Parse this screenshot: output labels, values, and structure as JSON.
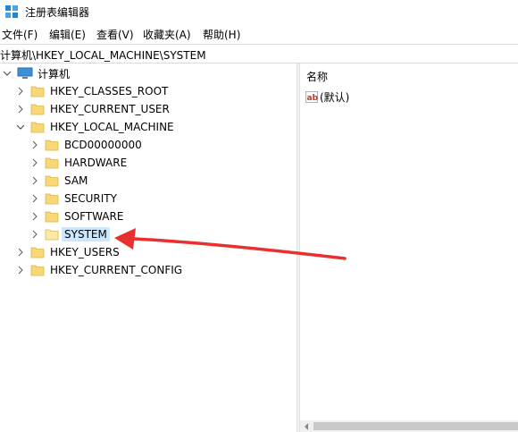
{
  "window": {
    "title": "注册表编辑器"
  },
  "menu": [
    {
      "label": "文件(F)"
    },
    {
      "label": "编辑(E)"
    },
    {
      "label": "查看(V)"
    },
    {
      "label": "收藏夹(A)"
    },
    {
      "label": "帮助(H)"
    }
  ],
  "address": {
    "path": "计算机\\HKEY_LOCAL_MACHINE\\SYSTEM"
  },
  "tree": {
    "root": "计算机",
    "hives": [
      {
        "label": "HKEY_CLASSES_ROOT"
      },
      {
        "label": "HKEY_CURRENT_USER"
      },
      {
        "label": "HKEY_LOCAL_MACHINE"
      },
      {
        "label": "HKEY_USERS"
      },
      {
        "label": "HKEY_CURRENT_CONFIG"
      }
    ],
    "hklm_children": [
      {
        "label": "BCD00000000"
      },
      {
        "label": "HARDWARE"
      },
      {
        "label": "SAM"
      },
      {
        "label": "SECURITY"
      },
      {
        "label": "SOFTWARE"
      },
      {
        "label": "SYSTEM"
      }
    ],
    "selected": "SYSTEM"
  },
  "list": {
    "column_name": "名称",
    "rows": [
      {
        "name": "(默认)",
        "icon": "reg-string-icon"
      }
    ]
  },
  "annotation": {
    "color": "#e8312f",
    "icon": "red-arrow"
  },
  "colors": {
    "selection": "#cce8ff",
    "folder": "#f8d775"
  }
}
